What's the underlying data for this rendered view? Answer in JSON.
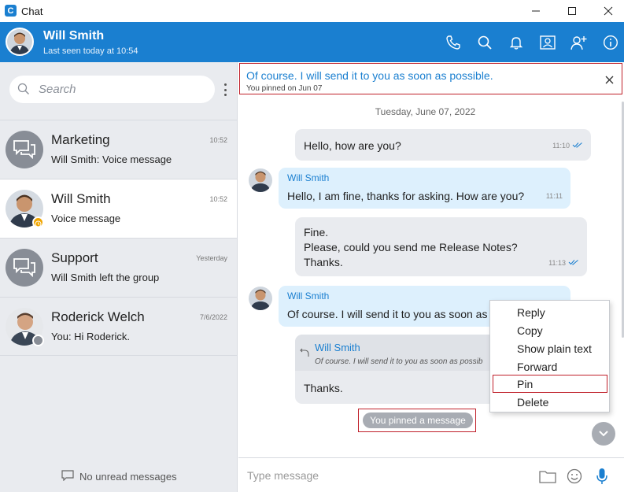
{
  "window": {
    "title": "Chat"
  },
  "header": {
    "name": "Will Smith",
    "status": "Last seen today at 10:54"
  },
  "search": {
    "placeholder": "Search"
  },
  "conversations": [
    {
      "name": "Marketing",
      "subtitle": "Will Smith: Voice message",
      "time": "10:52",
      "avatar": "group-chat-icon"
    },
    {
      "name": "Will Smith",
      "subtitle": "Voice message",
      "time": "10:52",
      "avatar": "user-photo",
      "status": "away",
      "status_color": "#f0a500"
    },
    {
      "name": "Support",
      "subtitle": "Will Smith left the group",
      "time": "Yesterday",
      "avatar": "group-chat-icon"
    },
    {
      "name": "Roderick Welch",
      "subtitle": "You: Hi Roderick.",
      "time": "7/6/2022",
      "avatar": "user-photo",
      "status": "offline",
      "status_color": "#888d96"
    }
  ],
  "unread_label": "No unread messages",
  "pinned": {
    "text": "Of course. I will send it to you as soon as possible.",
    "subtitle": "You pinned on Jun 07"
  },
  "date_separator": "Tuesday, June 07, 2022",
  "messages": [
    {
      "direction": "out",
      "text": "Hello, how are you?",
      "time": "11:10"
    },
    {
      "direction": "in",
      "sender": "Will Smith",
      "text": "Hello, I am fine, thanks for asking. How are you?",
      "time": "11:11"
    },
    {
      "direction": "out",
      "lines": [
        "Fine.",
        "Please, could you send me Release Notes?",
        "Thanks."
      ],
      "time": "11:13"
    },
    {
      "direction": "in",
      "sender": "Will Smith",
      "text": "Of course. I will send it to you as soon as p"
    },
    {
      "direction": "out",
      "quote_sender": "Will Smith",
      "quote_text": "Of course. I will send it to you as soon as possib",
      "text": "Thanks."
    }
  ],
  "system_note": "You pinned a message",
  "composer": {
    "placeholder": "Type message"
  },
  "context_menu": [
    "Reply",
    "Copy",
    "Show plain text",
    "Forward",
    "Pin",
    "Delete"
  ],
  "colors": {
    "accent": "#1a7fd0",
    "highlight": "#c0202a",
    "incoming": "#ddf0fd",
    "outgoing": "#e9ebef"
  }
}
